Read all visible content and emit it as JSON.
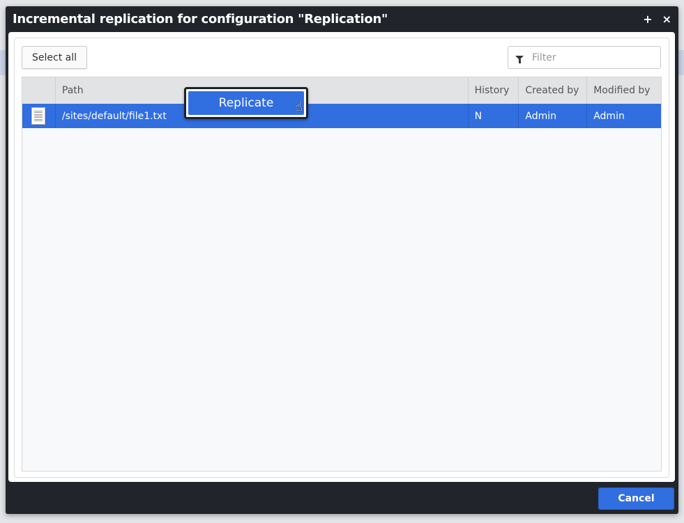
{
  "dialog": {
    "title": "Incremental replication for configuration \"Replication\"",
    "maximize_label": "+",
    "close_label": "×"
  },
  "toolbar": {
    "select_all_label": "Select all",
    "filter_placeholder": "Filter",
    "filter_value": "",
    "filter_icon": "funnel-icon"
  },
  "table": {
    "columns": [
      "",
      "Path",
      "History",
      "Created by",
      "Modified by"
    ],
    "rows": [
      {
        "icon": "file-icon",
        "path": "/sites/default/file1.txt",
        "history": "N",
        "created_by": "Admin",
        "modified_by": "Admin",
        "selected": true
      }
    ]
  },
  "context_menu": {
    "replicate_label": "Replicate"
  },
  "footer": {
    "cancel_label": "Cancel"
  },
  "colors": {
    "accent": "#316ee0",
    "titlebar": "#21252b",
    "header": "#e2e3e5"
  }
}
